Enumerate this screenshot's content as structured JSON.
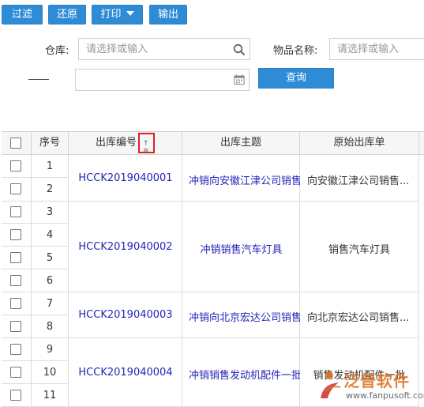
{
  "toolbar": {
    "filter_label": "过滤",
    "restore_label": "还原",
    "print_label": "打印",
    "export_label": "输出"
  },
  "filters": {
    "warehouse_label": "仓库:",
    "warehouse_placeholder": "请选择或输入",
    "item_name_label": "物品名称:",
    "item_name_placeholder": "请选择或输入",
    "query_label": "查询"
  },
  "table": {
    "headers": {
      "seq": "序号",
      "code": "出库编号",
      "subject": "出库主题",
      "original": "原始出库单"
    },
    "rows": [
      {
        "seq": "1"
      },
      {
        "seq": "2"
      },
      {
        "seq": "3"
      },
      {
        "seq": "4"
      },
      {
        "seq": "5"
      },
      {
        "seq": "6"
      },
      {
        "seq": "7"
      },
      {
        "seq": "8"
      },
      {
        "seq": "9"
      },
      {
        "seq": "10"
      },
      {
        "seq": "11"
      }
    ],
    "groups": [
      {
        "code": "HCCK2019040001",
        "subject": "冲销向安徽江津公司销售",
        "original": "向安徽江津公司销售..."
      },
      {
        "code": "HCCK2019040002",
        "subject": "冲销销售汽车灯具",
        "original": "销售汽车灯具"
      },
      {
        "code": "HCCK2019040003",
        "subject": "冲销向北京宏达公司销售",
        "original": "向北京宏达公司销售..."
      },
      {
        "code": "HCCK2019040004",
        "subject": "冲销销售发动机配件一批",
        "original": "销售发动机配件一批"
      }
    ]
  },
  "watermark": {
    "brand": "泛普软件",
    "url": "www.fanpusoft.com"
  },
  "colors": {
    "button_blue": "#2e8bd6",
    "link_blue": "#2424b8",
    "highlight_red": "#e02020",
    "watermark_orange": "#dc6e1e"
  }
}
